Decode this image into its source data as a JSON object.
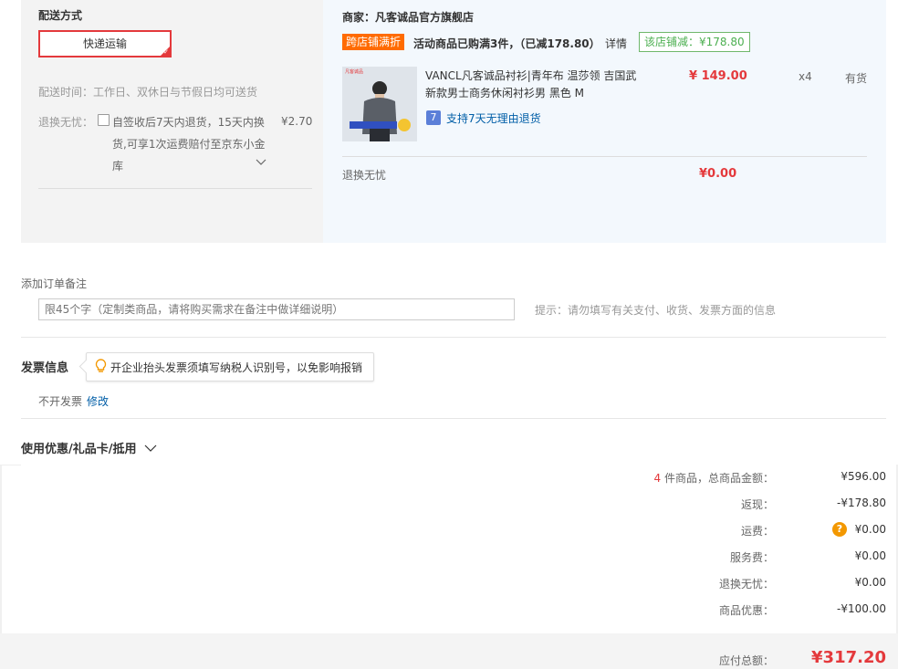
{
  "shipping": {
    "title": "配送方式",
    "method_label": "快递运输",
    "time_label": "配送时间：工作日、双休日与节假日均可送货",
    "return_label": "退换无忧：",
    "return_desc_line1": "自签收后7天内退货，15天内换",
    "return_desc_line2": "货,可享1次运费赔付至京东小金",
    "return_desc_line3": "库",
    "return_price": "¥2.70"
  },
  "seller": {
    "name": "商家：凡客诚品官方旗舰店",
    "promo_tag": "跨店铺满折",
    "promo_text": "活动商品已购满3件，（已减178.80）",
    "promo_detail_link": "详情",
    "store_discount": "该店铺减：¥178.80"
  },
  "product": {
    "title_line1": "VANCL凡客诚品衬衫|青年布 温莎领 吉国武",
    "title_line2": "新款男士商务休闲衬衫男 黑色 M",
    "return_badge": "7",
    "return_policy": "支持7天无理由退货",
    "price": "¥ 149.00",
    "quantity": "x4",
    "stock": "有货",
    "service_label": "退换无忧",
    "service_price": "¥0.00",
    "image_brand": "凡客诚品"
  },
  "order_note": {
    "title": "添加订单备注",
    "placeholder": "限45个字（定制类商品，请将购买需求在备注中做详细说明）",
    "hint": "提示：请勿填写有关支付、收货、发票方面的信息"
  },
  "invoice": {
    "title": "发票信息",
    "tip": "开企业抬头发票须填写纳税人识别号，以免影响报销",
    "status": "不开发票",
    "edit_link": "修改"
  },
  "coupon": {
    "title": "使用优惠/礼品卡/抵用"
  },
  "summary": {
    "count": "4",
    "count_suffix": "件商品，总商品金额：",
    "total_goods": "¥596.00",
    "rebate_label": "返现：",
    "rebate": "-¥178.80",
    "shipping_fee_label": "运费：",
    "shipping_fee": "¥0.00",
    "service_fee_label": "服务费：",
    "service_fee": "¥0.00",
    "return_worry_label": "退换无忧：",
    "return_worry": "¥0.00",
    "discount_label": "商品优惠：",
    "discount": "-¥100.00",
    "payable_label": "应付总额：",
    "payable": "¥317.20"
  },
  "colors": {
    "accent_red": "#e4393c",
    "promo_orange": "#ff6b00",
    "discount_green": "#4caf50",
    "link_blue": "#005ea7",
    "info_orange": "#f39800"
  }
}
